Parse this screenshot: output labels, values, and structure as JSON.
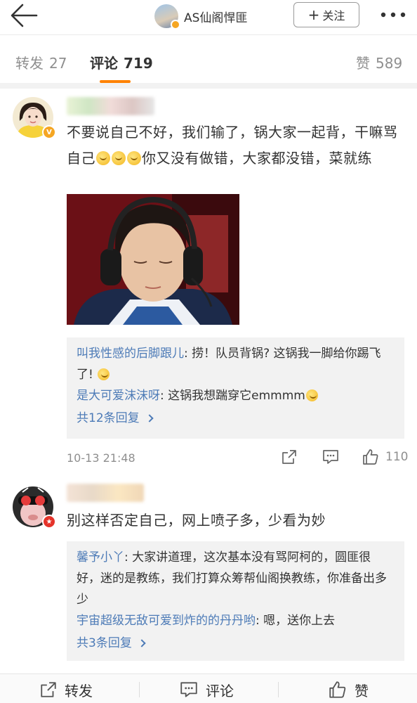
{
  "nav": {
    "title": "AS仙阁悍匪",
    "follow_plus": "+",
    "follow_label": "关注"
  },
  "tabs": {
    "repost_label": "转发",
    "repost_count": "27",
    "comment_label": "评论",
    "comment_count": "719",
    "like_label": "赞",
    "like_count": "589",
    "accent_color": "#ff8200"
  },
  "comments": [
    {
      "text_part1": "不要说自己不好，我们输了，锅大家一起背，干嘛骂自己",
      "text_part2": "你又没有做错，大家都没错，菜就练",
      "has_image": true,
      "replies": [
        {
          "name": "叫我性感的后脚跟儿",
          "text": ": 捞！队员背锅? 这锅我一脚给你踢飞了!"
        },
        {
          "name": "是大可爱沫沫呀",
          "text": ": 这锅我想踹穿它emmmm"
        }
      ],
      "more_replies": "共12条回复",
      "timestamp": "10-13 21:48",
      "like_count": "110"
    },
    {
      "text": "别这样否定自己，网上喷子多，少看为妙",
      "replies": [
        {
          "name": "馨予小丫",
          "text": ": 大家讲道理，这次基本没有骂阿柯的，圆匪很好，迷的是教练，我们打算众筹帮仙阁换教练，你准备出多少"
        },
        {
          "name": "宇宙超级无敌可爱到炸的的丹丹哟",
          "text": ": 嗯，送你上去"
        }
      ],
      "more_replies": "共3条回复"
    }
  ],
  "bottom_bar": {
    "repost_label": "转发",
    "comment_label": "评论",
    "like_label": "赞"
  },
  "colors": {
    "link_blue": "#4d7bb7",
    "reply_bg": "#f2f2f2",
    "verified_gold": "#f5a623",
    "badge_red": "#e5332a"
  }
}
